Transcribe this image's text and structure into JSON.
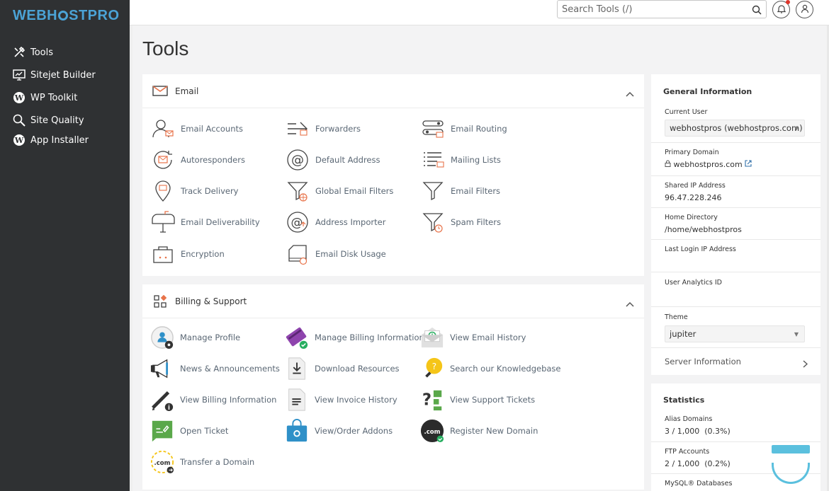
{
  "brand": {
    "logo_text_a": "WEBH",
    "logo_text_b": "STPRO"
  },
  "sidebar": {
    "items": [
      {
        "label": "Tools",
        "icon": "tools-icon"
      },
      {
        "label": "Sitejet Builder",
        "icon": "monitor-icon"
      },
      {
        "label": "WP Toolkit",
        "icon": "wordpress-icon"
      },
      {
        "label": "Site Quality",
        "icon": "magnifier-icon"
      },
      {
        "label": "App Installer",
        "icon": "wordpress-icon"
      }
    ]
  },
  "topbar": {
    "search_placeholder": "Search Tools (/)"
  },
  "page": {
    "title": "Tools"
  },
  "email": {
    "title": "Email",
    "tools": [
      "Email Accounts",
      "Forwarders",
      "Email Routing",
      "Autoresponders",
      "Default Address",
      "Mailing Lists",
      "Track Delivery",
      "Global Email Filters",
      "Email Filters",
      "Email Deliverability",
      "Address Importer",
      "Spam Filters",
      "Encryption",
      "Email Disk Usage"
    ]
  },
  "billing": {
    "title": "Billing & Support",
    "tools": [
      "Manage Profile",
      "Manage Billing Information",
      "View Email History",
      "News & Announcements",
      "Download Resources",
      "Search our Knowledgebase",
      "View Billing Information",
      "View Invoice History",
      "View Support Tickets",
      "Open Ticket",
      "View/Order Addons",
      "Register New Domain",
      "Transfer a Domain"
    ]
  },
  "general": {
    "title": "General Information",
    "current_user_label": "Current User",
    "current_user": "webhostpros (webhostpros.com)",
    "primary_domain_label": "Primary Domain",
    "primary_domain": "webhostpros.com",
    "shared_ip_label": "Shared IP Address",
    "shared_ip": "96.47.228.246",
    "home_dir_label": "Home Directory",
    "home_dir": "/home/webhostpros",
    "last_login_label": "Last Login IP Address",
    "last_login": "",
    "analytics_label": "User Analytics ID",
    "analytics": "",
    "theme_label": "Theme",
    "theme": "jupiter",
    "server_info": "Server Information"
  },
  "statistics": {
    "title": "Statistics",
    "items": [
      {
        "label": "Alias Domains",
        "value": "3 / 1,000",
        "pct": "(0.3%)"
      },
      {
        "label": "FTP Accounts",
        "value": "2 / 1,000",
        "pct": "(0.2%)"
      },
      {
        "label": "MySQL® Databases"
      }
    ]
  },
  "colors": {
    "sidebar": "#2f3133",
    "accent": "#4ba3d6",
    "link": "#2f6fa8",
    "email_icon": "#e8734a"
  }
}
